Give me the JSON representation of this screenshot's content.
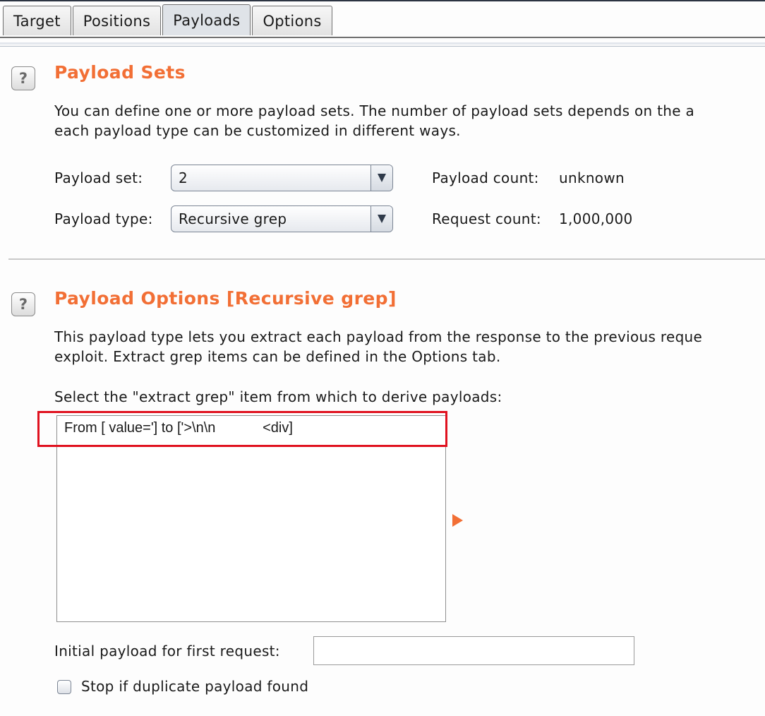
{
  "tabs": [
    {
      "label": "Target",
      "active": false
    },
    {
      "label": "Positions",
      "active": false
    },
    {
      "label": "Payloads",
      "active": true
    },
    {
      "label": "Options",
      "active": false
    }
  ],
  "payload_sets": {
    "help_icon": "?",
    "title": "Payload Sets",
    "description_line1": "You can define one or more payload sets. The number of payload sets depends on the a",
    "description_line2": "each payload type can be customized in different ways.",
    "payload_set_label": "Payload set:",
    "payload_set_value": "2",
    "payload_type_label": "Payload type:",
    "payload_type_value": "Recursive grep",
    "payload_count_label": "Payload count:",
    "payload_count_value": "unknown",
    "request_count_label": "Request count:",
    "request_count_value": "1,000,000"
  },
  "payload_options": {
    "help_icon": "?",
    "title": "Payload Options [Recursive grep]",
    "description_line1": "This payload type lets you extract each payload from the response to the previous reque",
    "description_line2": "exploit. Extract grep items can be defined in the Options tab.",
    "select_label": "Select the \"extract grep\" item from which to derive payloads:",
    "grep_items": [
      "From [ value='] to ['>\\n\\n            <div]"
    ],
    "initial_payload_label": "Initial payload for first request:",
    "initial_payload_value": "",
    "stop_duplicate_label": "Stop if duplicate payload found",
    "stop_duplicate_checked": false
  },
  "colors": {
    "heading": "#f26f35",
    "highlight_box": "#e0121f"
  }
}
